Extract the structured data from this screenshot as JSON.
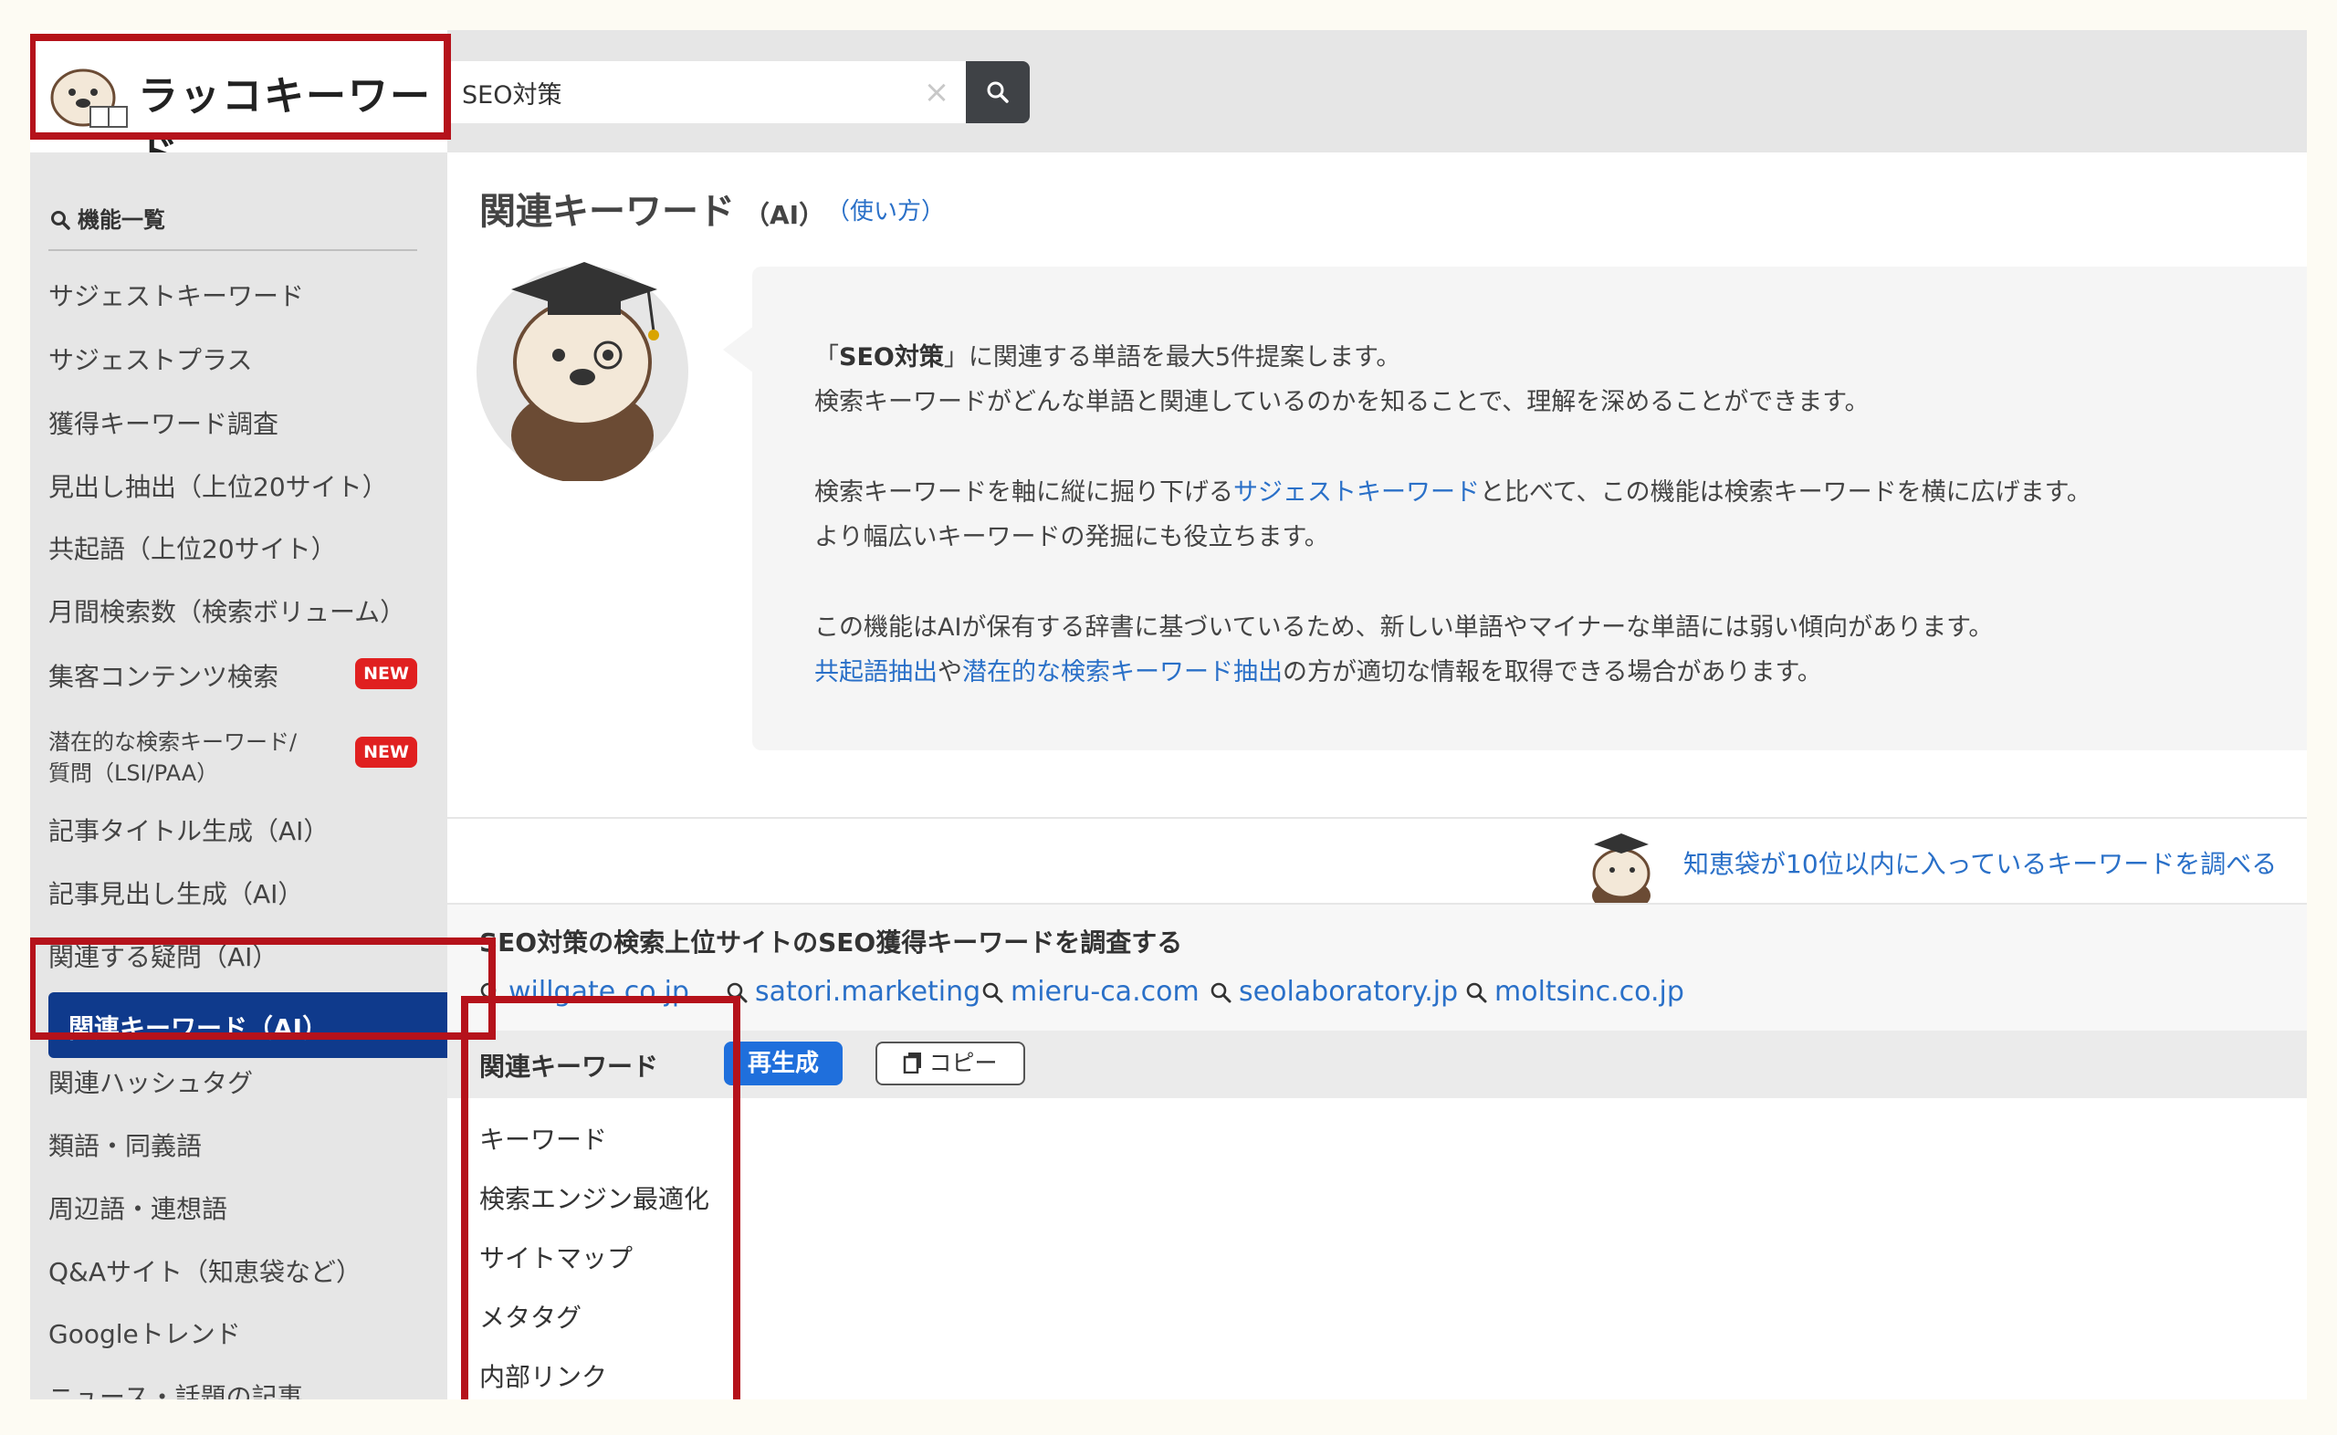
{
  "app": {
    "logo_text": "ラッコキーワード",
    "search_value": "SEO対策",
    "search_placeholder": "",
    "clear_symbol": "×"
  },
  "sidebar": {
    "title": "機能一覧",
    "items": [
      {
        "label": "サジェストキーワード"
      },
      {
        "label": "サジェストプラス"
      },
      {
        "label": "獲得キーワード調査"
      },
      {
        "label": "見出し抽出（上位20サイト）"
      },
      {
        "label": "共起語（上位20サイト）"
      },
      {
        "label": "月間検索数（検索ボリューム）"
      },
      {
        "label": "集客コンテンツ検索",
        "badge": "NEW"
      },
      {
        "label": "潜在的な検索キーワード/",
        "label2": "質問（LSI/PAA）",
        "badge": "NEW"
      },
      {
        "label": "記事タイトル生成（AI）"
      },
      {
        "label": "記事見出し生成（AI）"
      },
      {
        "label": "関連する疑問（AI）"
      },
      {
        "label": "関連キーワード（AI）",
        "active": true
      },
      {
        "label": "関連ハッシュタグ"
      },
      {
        "label": "類語・同義語"
      },
      {
        "label": "周辺語・連想語"
      },
      {
        "label": "Q&Aサイト（知恵袋など）"
      },
      {
        "label": "Googleトレンド"
      },
      {
        "label": "ニュース・話題の記事"
      }
    ]
  },
  "main": {
    "title": "関連キーワード",
    "title_suffix": "（AI）",
    "usage_link": "（使い方）",
    "info": {
      "l1_pre": "「",
      "l1_bold": "SEO対策",
      "l1_post": "」に関連する単語を最大5件提案します。",
      "l2": "検索キーワードがどんな単語と関連しているのかを知ることで、理解を深めることができます。",
      "l3_pre": "検索キーワードを軸に縦に掘り下げる",
      "l3_link": "サジェストキーワード",
      "l3_post": "と比べて、この機能は検索キーワードを横に広げます。",
      "l4": "より幅広いキーワードの発掘にも役立ちます。",
      "l5": "この機能はAIが保有する辞書に基づいているため、新しい単語やマイナーな単語には弱い傾向があります。",
      "l6_link1": "共起語抽出",
      "l6_mid": "や",
      "l6_link2": "潜在的な検索キーワード抽出",
      "l6_post": "の方が適切な情報を取得できる場合があります。"
    },
    "chiebukuro_link": "知恵袋が10位以内に入っているキーワードを調べる",
    "strip_title": "SEO対策の検索上位サイトのSEO獲得キーワードを調査する",
    "domains": [
      "willgate.co.jp",
      "satori.marketing",
      "mieru-ca.com",
      "seolaboratory.jp",
      "moltsinc.co.jp"
    ],
    "kw_title": "関連キーワード",
    "regen_label": "再生成",
    "copy_label": "コピー",
    "keywords": [
      "キーワード",
      "検索エンジン最適化",
      "サイトマップ",
      "メタタグ",
      "内部リンク"
    ]
  },
  "colors": {
    "accent_blue": "#2a70c8",
    "active_nav": "#0f3a8c",
    "highlight_red": "#b5121b",
    "new_badge": "#e02020"
  }
}
